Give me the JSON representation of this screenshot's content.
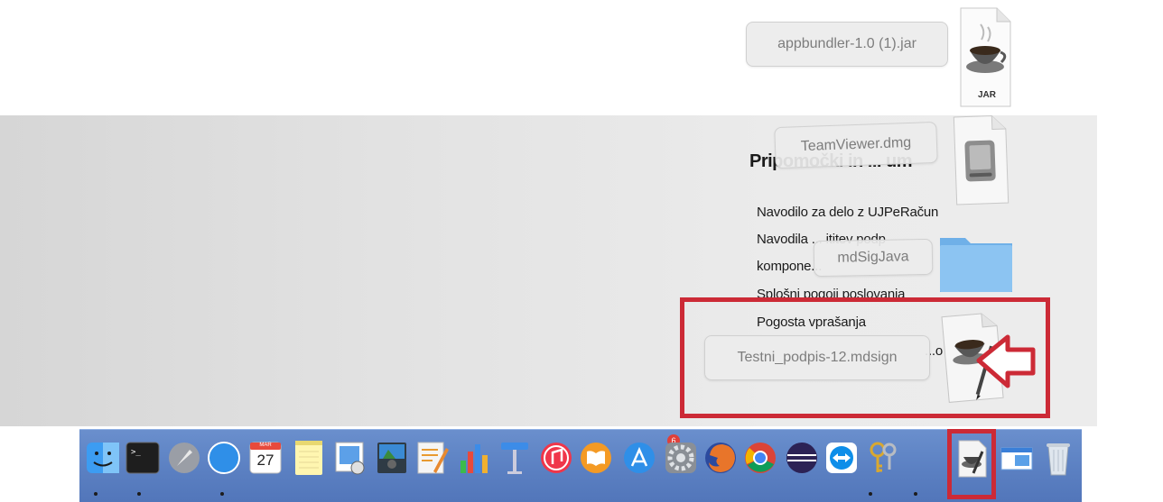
{
  "downloads": [
    {
      "label": "appbundler-1.0 (1).jar",
      "type": "jar",
      "icon_text": "JAR"
    },
    {
      "label": "TeamViewer.dmg",
      "type": "dmg"
    },
    {
      "label": "mdSigJava",
      "type": "folder"
    },
    {
      "label": "Testni_podpis-12.mdsign",
      "type": "mdsign"
    }
  ],
  "webpage": {
    "heading": "Pripomočki in ... um",
    "links": [
      "Navodilo za delo z UJPeRačun",
      "Navodila ... ititev podp",
      "kompone...",
      "Splošni pogoji poslovanja",
      "Pogosta vprašanja",
      "...o"
    ]
  },
  "dock": {
    "apps": [
      "Finder",
      "Terminal",
      "Launchpad",
      "Safari",
      "Calendar",
      "Notes",
      "Preview",
      "Photo Booth",
      "Pages",
      "Numbers",
      "Keynote",
      "iTunes",
      "iBooks",
      "App Store",
      "System Preferences",
      "Firefox",
      "Chrome",
      "Eclipse",
      "TeamViewer",
      "Keychain Access",
      "Java Launcher",
      "Downloads Stack",
      "Trash"
    ],
    "calendar": {
      "month": "MAR",
      "day": "27"
    },
    "app_store_badge": "6"
  },
  "colors": {
    "highlight": "#cc2a36",
    "dock": "#5b80c2"
  }
}
